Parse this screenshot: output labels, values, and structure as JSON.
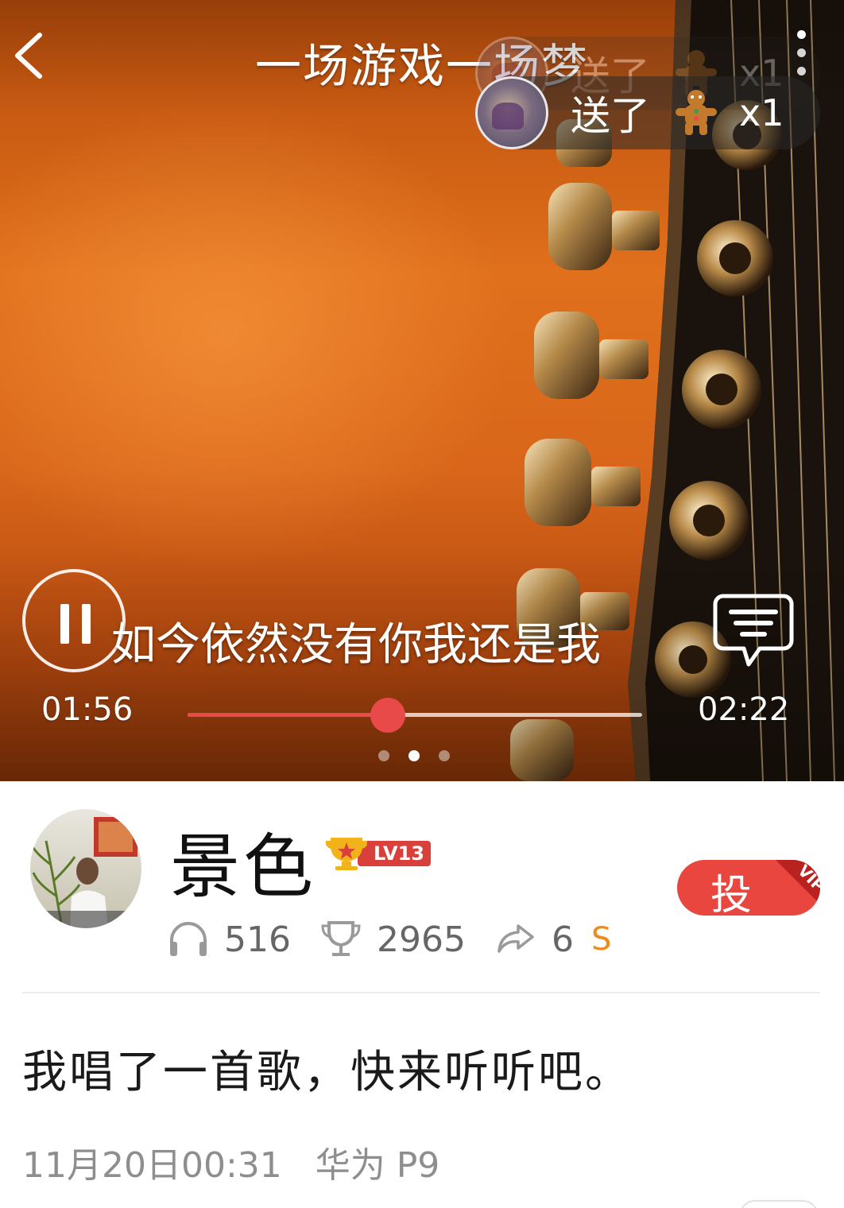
{
  "player": {
    "title": "一场游戏一场梦",
    "lyric": "如今依然没有你我还是我",
    "current_time": "01:56",
    "total_time": "02:22",
    "progress": 0.44,
    "page_indicator": {
      "count": 3,
      "active_index": 1
    },
    "colors": {
      "accent": "#e84a4a",
      "background": "#d9661a"
    }
  },
  "gifts": [
    {
      "text": "送了",
      "count": "x1",
      "icon": "gingerbread-man-icon"
    },
    {
      "text": "送了",
      "count": "x1",
      "icon": "gingerbread-man-icon"
    }
  ],
  "user": {
    "name": "景色",
    "level": "LV13",
    "stats": {
      "listens": "516",
      "trophies": "2965",
      "shares": "6",
      "badge": "S"
    }
  },
  "vote": {
    "label": "投",
    "corner": "VIP"
  },
  "post": {
    "text": "我唱了一首歌，快来听听吧。",
    "timestamp": "11月20日00:31",
    "device": "华为 P9"
  },
  "icons": {
    "back": "back-arrow-icon",
    "more": "more-vertical-icon",
    "pause": "pause-icon",
    "comment": "comment-icon",
    "listens": "headphones-icon",
    "trophies": "trophy-icon",
    "shares": "share-icon",
    "level": "trophy-level-icon"
  }
}
